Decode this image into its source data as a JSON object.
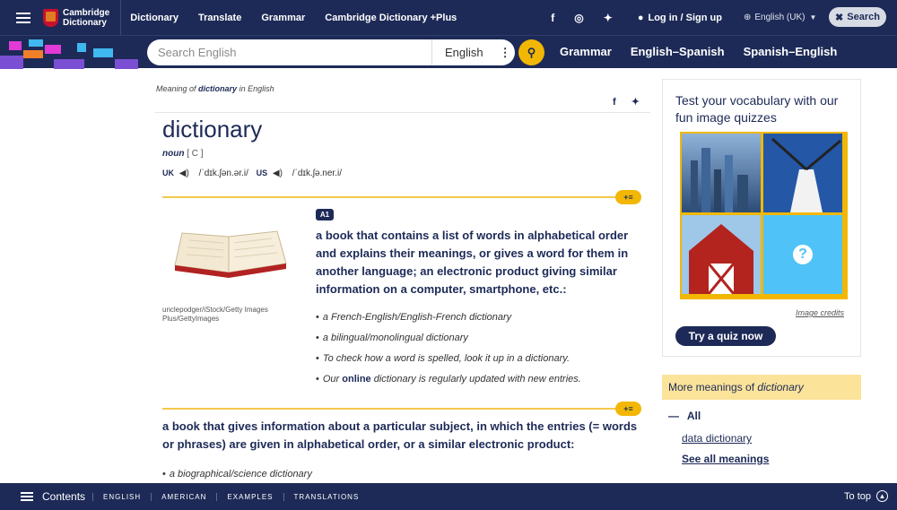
{
  "header": {
    "logo_line1": "Cambridge",
    "logo_line2": "Dictionary",
    "nav": [
      "Dictionary",
      "Translate",
      "Grammar",
      "Cambridge Dictionary +Plus"
    ],
    "social_icons": [
      "facebook-icon",
      "instagram-icon",
      "twitter-icon"
    ],
    "login": "Log in / Sign up",
    "language": "English (UK)",
    "search_button": "Search"
  },
  "searchbar": {
    "placeholder": "Search English",
    "dictionary_select": "English",
    "subnav": [
      "Grammar",
      "English–Spanish",
      "Spanish–English"
    ]
  },
  "entry": {
    "meaning_of_prefix": "Meaning of",
    "meaning_of_word": "dictionary",
    "meaning_of_suffix": "in English",
    "headword": "dictionary",
    "pos": "noun",
    "grammar": "[ C ]",
    "uk_label": "UK",
    "uk_ipa": "/ˈdɪk.ʃən.ər.i/",
    "us_label": "US",
    "us_ipa": "/ˈdɪk.ʃə.ner.i/",
    "level": "A1",
    "image_credit": "unclepodger/iStock/Getty Images Plus/GettyImages",
    "definition1": "a book that contains a list of words in alphabetical order and explains their meanings, or gives a word for them in another language; an electronic product giving similar information on a computer, smartphone, etc.:",
    "examples1": [
      "a French-English/English-French dictionary",
      "a bilingual/monolingual dictionary",
      "To check how a word is spelled, look it up in a dictionary."
    ],
    "example4_pre": "Our",
    "example4_bold": "online",
    "example4_post": "dictionary is regularly updated with new entries.",
    "definition2": "a book that gives information about a particular subject, in which the entries (= words or phrases) are given in alphabetical order, or a similar electronic product:",
    "example2_1": "a biographical/science dictionary"
  },
  "quiz": {
    "title": "Test your vocabulary with our fun image quizzes",
    "image_credits": "Image credits",
    "button": "Try a quiz now",
    "question_mark": "?"
  },
  "more_meanings": {
    "label": "More meanings of",
    "word": "dictionary",
    "all": "All",
    "link1": "data dictionary",
    "link2": "See all meanings"
  },
  "footer": {
    "contents": "Contents",
    "tabs": [
      "ENGLISH",
      "AMERICAN",
      "EXAMPLES",
      "TRANSLATIONS"
    ],
    "to_top": "To top"
  },
  "colors": {
    "navy": "#1d2a57",
    "gold": "#f2b705",
    "light_gold": "#fbe39a",
    "quiz_cyan": "#4fc3f7"
  }
}
